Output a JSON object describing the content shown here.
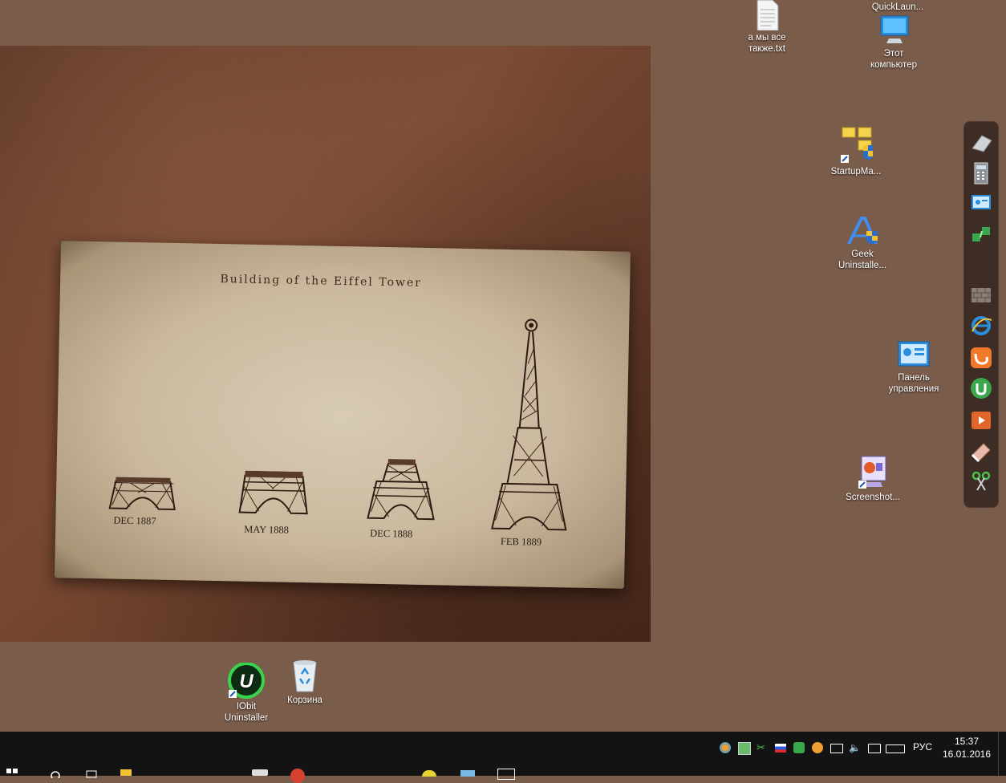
{
  "wallpaper": {
    "title": "Building of the Eiffel Tower",
    "stages": [
      {
        "label": "DEC 1887"
      },
      {
        "label": "MAY 1888"
      },
      {
        "label": "DEC 1888"
      },
      {
        "label": "FEB 1889"
      }
    ]
  },
  "desktop_icons": {
    "txt_file": "а мы все\nтакже.txt",
    "quicklaunch": "QuickLaun...",
    "this_pc": "Этот\nкомпьютер",
    "startup_manager": "StartupMa...",
    "geek_uninstaller": "Geek\nUninstalle...",
    "control_panel": "Панель\nуправления",
    "screenshot": "Screenshot...",
    "iobit": "IObit\nUninstaller",
    "recycle_bin": "Корзина"
  },
  "dock": {
    "items": [
      "eraser-icon",
      "calculator-icon",
      "control-panel-icon",
      "network-icon",
      "firewall-icon",
      "ie-icon",
      "ucbrowser-icon",
      "utorrent-icon",
      "media-player-icon",
      "eraser-tool-icon",
      "scissors-icon"
    ]
  },
  "taskbar": {
    "language": "РУС",
    "time": "15:37",
    "date": "16.01.2016"
  },
  "colors": {
    "desktop": "#7a5c4b",
    "taskbar": "#131313",
    "paper": "#d8cbb4"
  }
}
